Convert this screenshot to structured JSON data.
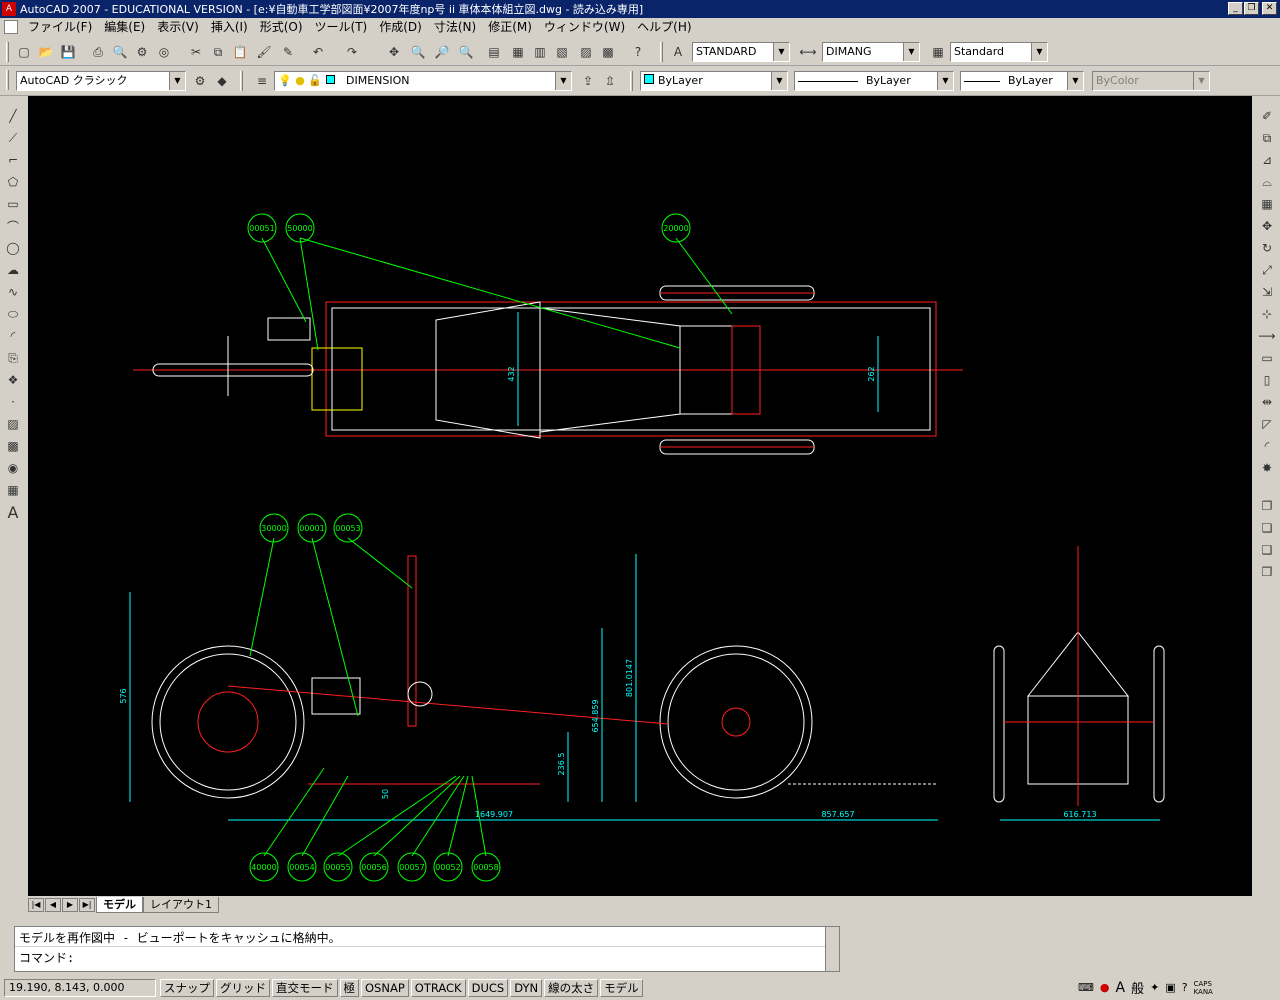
{
  "window": {
    "title": "AutoCAD 2007 - EDUCATIONAL VERSION - [e:¥自動車工学部図面¥2007年度np号 ii 車体本体組立図.dwg - 読み込み専用]",
    "min": "_",
    "restore": "❐",
    "close": "✕"
  },
  "menu": [
    "ファイル(F)",
    "編集(E)",
    "表示(V)",
    "挿入(I)",
    "形式(O)",
    "ツール(T)",
    "作成(D)",
    "寸法(N)",
    "修正(M)",
    "ウィンドウ(W)",
    "ヘルプ(H)"
  ],
  "toolbar": {
    "text_style": "STANDARD",
    "dim_style": "DIMANG",
    "table_style": "Standard",
    "workspace": "AutoCAD クラシック",
    "layer": "DIMENSION",
    "color": "ByLayer",
    "linetype": "ByLayer",
    "lineweight": "ByLayer",
    "plotstyle": "ByColor"
  },
  "tabs": [
    "モデル",
    "レイアウト1"
  ],
  "command": {
    "line1": "モデルを再作図中 - ビューポートをキャッシュに格納中。",
    "prompt": "コマンド:"
  },
  "status": {
    "coords": "19.190, 8.143, 0.000",
    "buttons": [
      "スナップ",
      "グリッド",
      "直交モード",
      "極",
      "OSNAP",
      "OTRACK",
      "DUCS",
      "DYN",
      "線の太さ",
      "モデル"
    ],
    "right": [
      "A",
      "般",
      "CAPS",
      "KANA"
    ]
  },
  "drawing": {
    "balloons_top": [
      "00051",
      "50000",
      "20000"
    ],
    "balloons_side": [
      "30000",
      "00001",
      "00053"
    ],
    "balloons_bottom": [
      "40000",
      "00054",
      "00055",
      "00056",
      "00057",
      "00052",
      "00058"
    ],
    "dims": {
      "top_432": "432",
      "top_262": "262",
      "side_576": "576",
      "side_801": "801.0147",
      "side_654": "654.859",
      "side_236": "236.5",
      "side_50": "50",
      "side_1649": "1649.907",
      "side_857": "857.657",
      "front_616": "616.713"
    },
    "colors": {
      "background": "#000000",
      "frame": "#ff2020",
      "outline": "#ffffff",
      "balloon": "#00ff00",
      "dimension": "#00ffff",
      "yellow": "#ffff00"
    }
  }
}
